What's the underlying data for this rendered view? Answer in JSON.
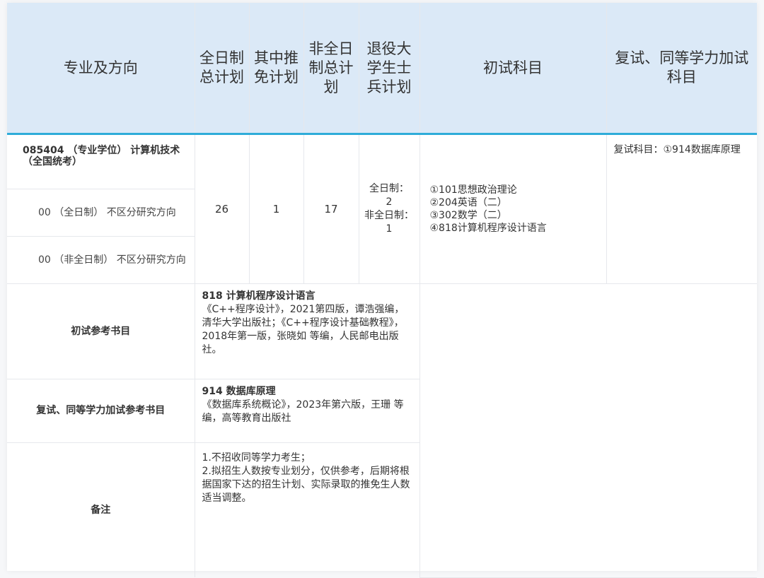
{
  "header": {
    "major": "专业及方向",
    "fulltime_plan": "全日制总计划",
    "exempt_plan": "其中推免计划",
    "parttime_plan": "非全日制总计划",
    "veteran_plan": "退役大学生士兵计划",
    "exam_subjects": "初试科目",
    "retest_subjects": "复试、同等学力加试科目"
  },
  "program": {
    "title": "085404 （专业学位） 计算机技术（全国统考）",
    "directions": [
      "00 （全日制） 不区分研究方向",
      "00 （非全日制） 不区分研究方向"
    ],
    "fulltime_total": "26",
    "exempt": "1",
    "parttime_total": "17",
    "veteran_line1": "全日制：",
    "veteran_line2": "2",
    "veteran_line3": "非全日制：1",
    "exam": [
      "①101思想政治理论",
      "②204英语（二）",
      "③302数学（二）",
      "④818计算机程序设计语言"
    ],
    "retest": "复试科目：①914数据库原理"
  },
  "refs": {
    "exam_label": "初试参考书目",
    "exam_title": "818 计算机程序设计语言",
    "exam_text": "《C++程序设计》，2021第四版，谭浩强编，清华大学出版社；《C++程序设计基础教程》，2018年第一版，张晓如 等编，人民邮电出版社。",
    "retest_label": "复试、同等学力加试参考书目",
    "retest_title": "914 数据库原理",
    "retest_text": "《数据库系统概论》，2023年第六版，王珊 等编，高等教育出版社",
    "notes_label": "备注",
    "notes": [
      "1.不招收同等学力考生；",
      "2.拟招生人数按专业划分，仅供参考，后期将根据国家下达的招生计划、实际录取的推免生人数适当调整。"
    ]
  }
}
